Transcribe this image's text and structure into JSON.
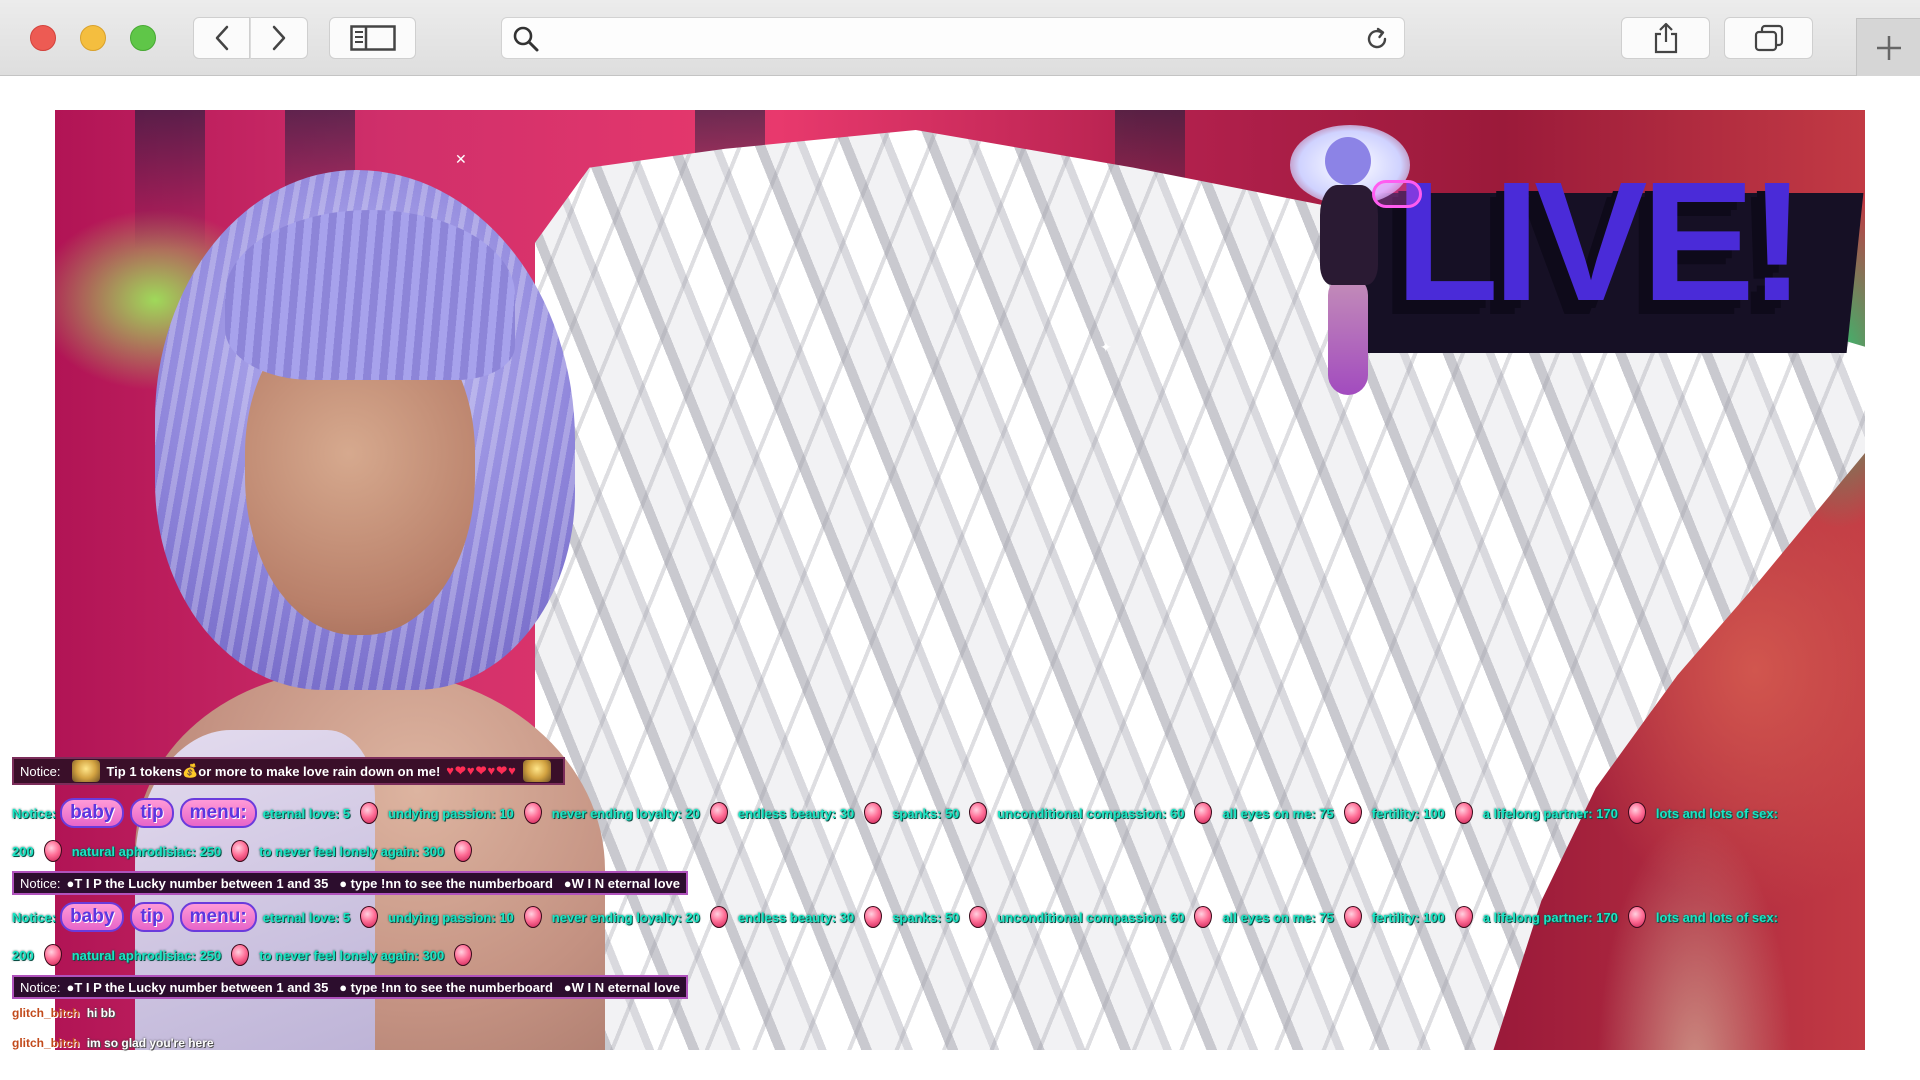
{
  "browser": {
    "address_placeholder": "",
    "address_value": ""
  },
  "stream": {
    "live_logo": "LIVE!"
  },
  "chat": {
    "tip_notice": {
      "label": "Notice:",
      "text": "Tip 1 tokens",
      "text_after": " or more to make love rain down on me!",
      "hearts": "♥❤♥❤♥❤♥"
    },
    "menu_label": "Notice:",
    "menu_pills": [
      "baby",
      "tip",
      "menu:"
    ],
    "menu_items_row1": [
      "eternal love: 5",
      "undying passion: 10",
      "never ending loyalty: 20",
      "endless beauty: 30",
      "spanks: 50",
      "unconditional compassion: 60",
      "all eyes on me: 75",
      "fertility: 100",
      "a lifelong partner: 170",
      "lots and lots of sex:"
    ],
    "menu_items_row2": [
      "200",
      "natural aphrodisiac: 250",
      "to never feel lonely again: 300"
    ],
    "lucky_notice": {
      "label": "Notice:",
      "text": "●T I P the Lucky number between 1 and 35",
      "text2": "● type !nn to see the numberboard",
      "text3": "●W I N eternal love"
    },
    "messages": [
      {
        "user": "glitch_bitch",
        "text": "hi bb"
      },
      {
        "user": "glitch_bitch",
        "text": "im so glad you're here"
      }
    ]
  }
}
